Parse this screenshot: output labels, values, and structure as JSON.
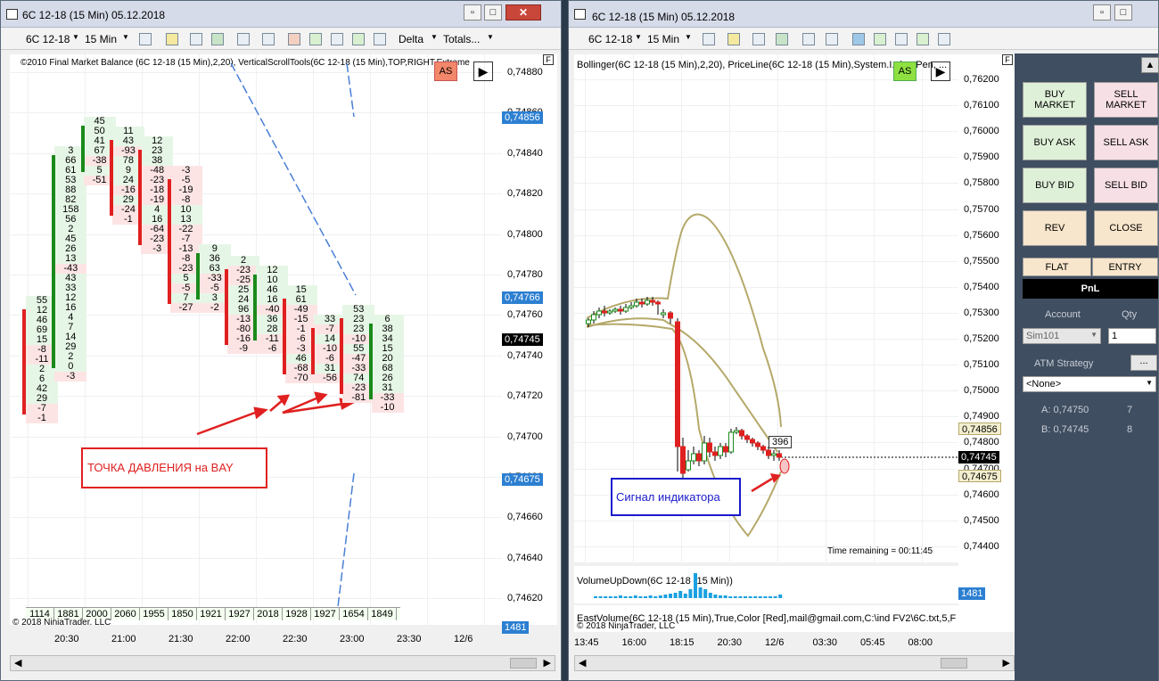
{
  "left": {
    "title": "6C 12-18 (15 Min)  05.12.2018",
    "toolbar": {
      "instrument": "6C 12-18",
      "interval": "15 Min",
      "delta": "Delta",
      "totals": "Totals..."
    },
    "indicator_label": "©2010 Final Market Balance  (6C 12-18 (15 Min),2,20), VerticalScrollTools(6C 12-18 (15 Min),TOP,RIGHT,Extreme",
    "as": "AS",
    "f": "F",
    "prices": [
      "0,74880",
      "0,74860",
      "0,74840",
      "0,74820",
      "0,74800",
      "0,74780",
      "0,74760",
      "0,74740",
      "0,74720",
      "0,74700",
      "0,74680",
      "0,74660",
      "0,74640",
      "0,74620"
    ],
    "tags": {
      "high": "0,74856",
      "mid": "0,74766",
      "last": "0,74745",
      "low": "0,74675",
      "vol": "1481"
    },
    "times": [
      "20:30",
      "21:00",
      "21:30",
      "22:00",
      "22:30",
      "23:00",
      "23:30",
      "12/6"
    ],
    "volumes": [
      "1114",
      "1881",
      "2000",
      "2060",
      "1955",
      "1850",
      "1921",
      "1927",
      "2018",
      "1928",
      "1927",
      "1654",
      "1849"
    ],
    "annotation": "ТОЧКА ДАВЛЕНИЯ на BAY",
    "copyright": "© 2018 NinjaTrader, LLC",
    "footprint": [
      [
        "55",
        "12",
        "46",
        "69",
        "15",
        "-8",
        "-11",
        "2",
        "6",
        "42",
        "29",
        "-7",
        "-1"
      ],
      [
        "3",
        "66",
        "61",
        "53",
        "88",
        "82",
        "158",
        "56",
        "2",
        "45",
        "26",
        "13",
        "-43",
        "43",
        "33",
        "12",
        "16",
        "4",
        "7",
        "14",
        "29",
        "2",
        "0",
        "-3"
      ],
      [
        "45",
        "50",
        "41",
        "67",
        "-38",
        "5",
        "-51"
      ],
      [
        "11",
        "43",
        "-93",
        "78",
        "9",
        "24",
        "-16",
        "29",
        "-24",
        "-1"
      ],
      [
        "12",
        "23",
        "38",
        "-48",
        "-23",
        "-18",
        "-19",
        "4",
        "16",
        "-64",
        "-23",
        "-3"
      ],
      [
        "-3",
        "-5",
        "-19",
        "-8",
        "10",
        "13",
        "-22",
        "-7",
        "-13",
        "-8",
        "-23",
        "5",
        "-5",
        "7",
        "-27"
      ],
      [
        "9",
        "36",
        "63",
        "-33",
        "-5",
        "3",
        "-2"
      ],
      [
        "2",
        "-23",
        "-25",
        "25",
        "24",
        "96",
        "-13",
        "-80",
        "-16",
        "-9"
      ],
      [
        "12",
        "10",
        "46",
        "16",
        "-40",
        "36",
        "28",
        "-11",
        "-6"
      ],
      [
        "15",
        "61",
        "-49",
        "-15",
        "-1",
        "-6",
        "-3",
        "46",
        "-68",
        "-70"
      ],
      [
        "33",
        "-7",
        "14",
        "-10",
        "-6",
        "31",
        "-56"
      ],
      [
        "53",
        "23",
        "23",
        "-10",
        "55",
        "-47",
        "-33",
        "74",
        "-23",
        "-81"
      ],
      [
        "6",
        "38",
        "34",
        "15",
        "20",
        "68",
        "26",
        "31",
        "-33",
        "-10"
      ]
    ]
  },
  "right": {
    "title": "6C 12-18 (15 Min)  05.12.2018",
    "toolbar": {
      "instrument": "6C 12-18",
      "interval": "15 Min"
    },
    "indicator_label": "Bollinger(6C 12-18 (15 Min),2,20), PriceLine(6C 12-18 (15 Min),System.I...ing.Pen, ...",
    "as": "AS",
    "f": "F",
    "prices": [
      "0,76200",
      "0,76100",
      "0,76000",
      "0,75900",
      "0,75800",
      "0,75700",
      "0,75600",
      "0,75500",
      "0,75400",
      "0,75300",
      "0,75200",
      "0,75100",
      "0,75000",
      "0,74900",
      "0,74800",
      "0,74700",
      "0,74600",
      "0,74500",
      "0,74400"
    ],
    "tags": {
      "high": "0,74856",
      "mid": "0,74745",
      "low": "0,74675",
      "vol": "1481"
    },
    "time_remaining": "Time remaining = 00:11:45",
    "signal": "Сигнал индикатора",
    "box_value": "396",
    "vol_label": "VolumeUpDown(6C 12-18 (15 Min))",
    "east_label": "EastVolume(6C 12-18 (15 Min),True,Color [Red],mail@gmail.com,C:\\ind FV2\\6C.txt,5,F",
    "copyright": "© 2018 NinjaTrader, LLC",
    "times": [
      "13:45",
      "16:00",
      "18:15",
      "20:30",
      "12/6",
      "03:30",
      "05:45",
      "08:00"
    ]
  },
  "panel": {
    "buy_market": "BUY MARKET",
    "sell_market": "SELL MARKET",
    "buy_ask": "BUY ASK",
    "sell_ask": "SELL ASK",
    "buy_bid": "BUY BID",
    "sell_bid": "SELL BID",
    "rev": "REV",
    "close": "CLOSE",
    "flat": "FLAT",
    "entry": "ENTRY",
    "pnl": "PnL",
    "account_label": "Account",
    "qty_label": "Qty",
    "account": "Sim101",
    "qty": "1",
    "atm_label": "ATM Strategy",
    "atm_value": "<None>",
    "ellipsis": "...",
    "a_label": "A: 0,74750",
    "a_qty": "7",
    "b_label": "B: 0,74745",
    "b_qty": "8"
  },
  "colors": {
    "up": "#1a8a1a",
    "down": "#e02020",
    "tag_blue": "#2c7fd1",
    "annotation": "#e02020",
    "signal": "#1a1acc",
    "bollinger": "#b5a96a"
  }
}
